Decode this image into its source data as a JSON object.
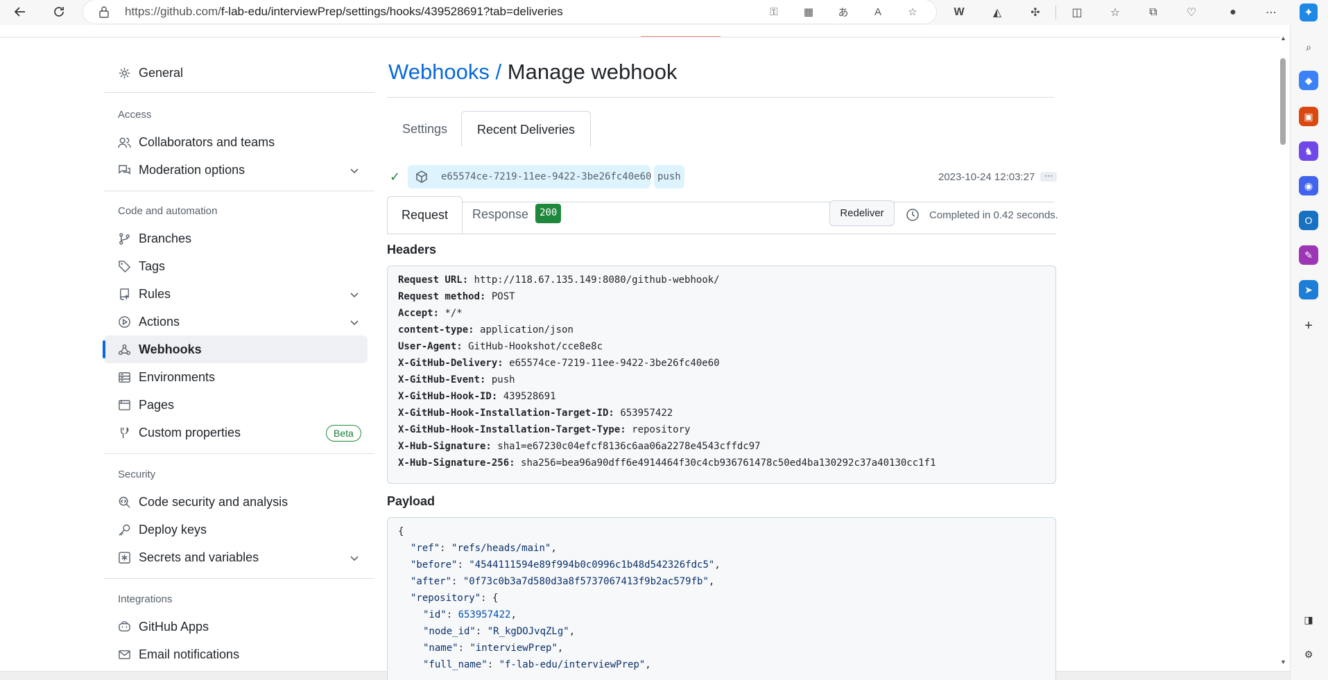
{
  "browser": {
    "url_prefix": "https://github.com/",
    "url_path": "f-lab-edu/interviewPrep/settings/hooks/439528691?tab=deliveries"
  },
  "sidebar": {
    "general": "General",
    "access_heading": "Access",
    "collaborators": "Collaborators and teams",
    "moderation": "Moderation options",
    "code_heading": "Code and automation",
    "branches": "Branches",
    "tags": "Tags",
    "rules": "Rules",
    "actions": "Actions",
    "webhooks": "Webhooks",
    "environments": "Environments",
    "pages": "Pages",
    "custom_properties": "Custom properties",
    "beta_label": "Beta",
    "security_heading": "Security",
    "code_security": "Code security and analysis",
    "deploy_keys": "Deploy keys",
    "secrets": "Secrets and variables",
    "integrations_heading": "Integrations",
    "github_apps": "GitHub Apps",
    "email_notifications": "Email notifications"
  },
  "main": {
    "breadcrumb": "Webhooks",
    "separator": "/",
    "title": "Manage webhook",
    "tabs": {
      "settings": "Settings",
      "recent": "Recent Deliveries"
    },
    "delivery": {
      "guid": "e65574ce-7219-11ee-9422-3be26fc40e60",
      "event": "push",
      "timestamp": "2023-10-24 12:03:27",
      "more": "···"
    },
    "subtabs": {
      "request": "Request",
      "response": "Response",
      "status_code": "200"
    },
    "redeliver": "Redeliver",
    "completed": "Completed in 0.42 seconds.",
    "headers_heading": "Headers",
    "headers": [
      {
        "key": "Request URL:",
        "value": "http://118.67.135.149:8080/github-webhook/"
      },
      {
        "key": "Request method:",
        "value": "POST"
      },
      {
        "key": "Accept:",
        "value": "*/*"
      },
      {
        "key": "content-type:",
        "value": "application/json"
      },
      {
        "key": "User-Agent:",
        "value": "GitHub-Hookshot/cce8e8c"
      },
      {
        "key": "X-GitHub-Delivery:",
        "value": "e65574ce-7219-11ee-9422-3be26fc40e60"
      },
      {
        "key": "X-GitHub-Event:",
        "value": "push"
      },
      {
        "key": "X-GitHub-Hook-ID:",
        "value": "439528691"
      },
      {
        "key": "X-GitHub-Hook-Installation-Target-ID:",
        "value": "653957422"
      },
      {
        "key": "X-GitHub-Hook-Installation-Target-Type:",
        "value": "repository"
      },
      {
        "key": "X-Hub-Signature:",
        "value": "sha1=e67230c04efcf8136c6aa06a2278e4543cffdc97"
      },
      {
        "key": "X-Hub-Signature-256:",
        "value": "sha256=bea96a90dff6e4914464f30c4cb936761478c50ed4ba130292c37a40130cc1f1"
      }
    ],
    "payload_heading": "Payload",
    "payload": {
      "open": "{",
      "ref_key": "\"ref\"",
      "ref_val": "\"refs/heads/main\"",
      "before_key": "\"before\"",
      "before_val": "\"4544111594e89f994b0c0996c1b48d542326fdc5\"",
      "after_key": "\"after\"",
      "after_val": "\"0f73c0b3a7d580d3a8f5737067413f9b2ac579fb\"",
      "repo_key": "\"repository\"",
      "id_key": "\"id\"",
      "id_val": "653957422",
      "node_key": "\"node_id\"",
      "node_val": "\"R_kgDOJvqZLg\"",
      "name_key": "\"name\"",
      "name_val": "\"interviewPrep\"",
      "full_key": "\"full_name\"",
      "full_val": "\"f-lab-edu/interviewPrep\""
    }
  }
}
